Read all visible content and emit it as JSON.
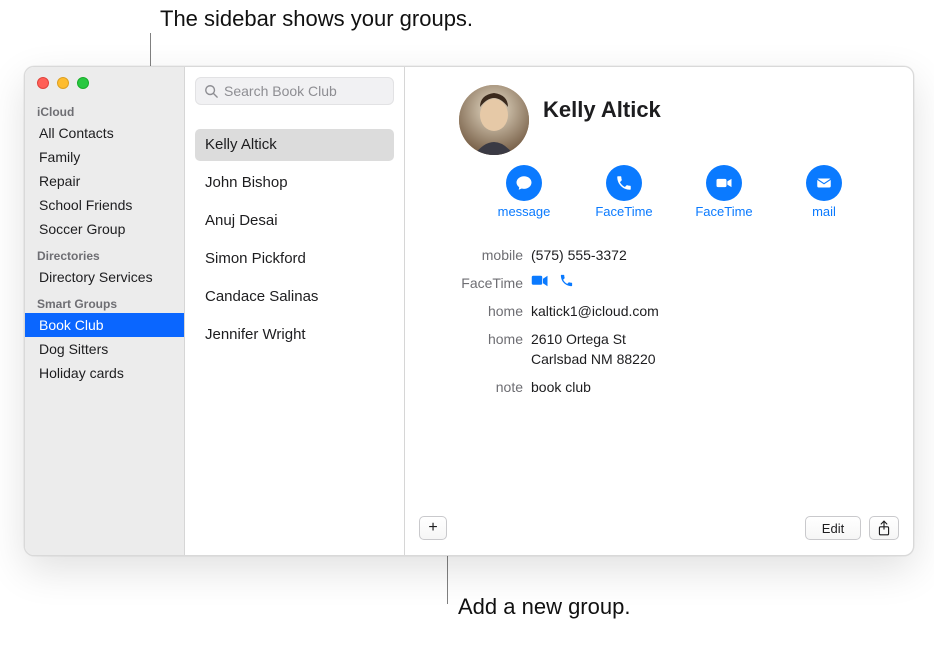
{
  "callouts": {
    "top": "The sidebar shows your groups.",
    "bottom": "Add a new group."
  },
  "sidebar": {
    "sections": [
      {
        "header": "iCloud",
        "items": [
          {
            "label": "All Contacts"
          },
          {
            "label": "Family"
          },
          {
            "label": "Repair"
          },
          {
            "label": "School Friends"
          },
          {
            "label": "Soccer Group"
          }
        ]
      },
      {
        "header": "Directories",
        "items": [
          {
            "label": "Directory Services"
          }
        ]
      },
      {
        "header": "Smart Groups",
        "items": [
          {
            "label": "Book Club",
            "selected": true
          },
          {
            "label": "Dog Sitters"
          },
          {
            "label": "Holiday cards"
          }
        ]
      }
    ]
  },
  "search": {
    "placeholder": "Search Book Club"
  },
  "list": {
    "items": [
      {
        "name": "Kelly Altick",
        "selected": true
      },
      {
        "name": "John Bishop"
      },
      {
        "name": "Anuj Desai"
      },
      {
        "name": "Simon Pickford"
      },
      {
        "name": "Candace Salinas"
      },
      {
        "name": "Jennifer Wright"
      }
    ]
  },
  "detail": {
    "name": "Kelly Altick",
    "actions": [
      {
        "id": "message",
        "label": "message",
        "icon": "message-bubble-icon"
      },
      {
        "id": "facetime-audio",
        "label": "FaceTime",
        "icon": "phone-icon"
      },
      {
        "id": "facetime-video",
        "label": "FaceTime",
        "icon": "video-icon"
      },
      {
        "id": "mail",
        "label": "mail",
        "icon": "envelope-icon"
      }
    ],
    "fields": [
      {
        "label": "mobile",
        "value": "(575) 555-3372"
      },
      {
        "label": "FaceTime",
        "facetime_icons": true
      },
      {
        "label": "home",
        "value": "kaltick1@icloud.com"
      },
      {
        "label": "home",
        "value": "2610 Ortega St\nCarlsbad NM 88220"
      },
      {
        "label": "note",
        "value": "book club"
      }
    ],
    "footer": {
      "add": "+",
      "edit": "Edit"
    }
  }
}
